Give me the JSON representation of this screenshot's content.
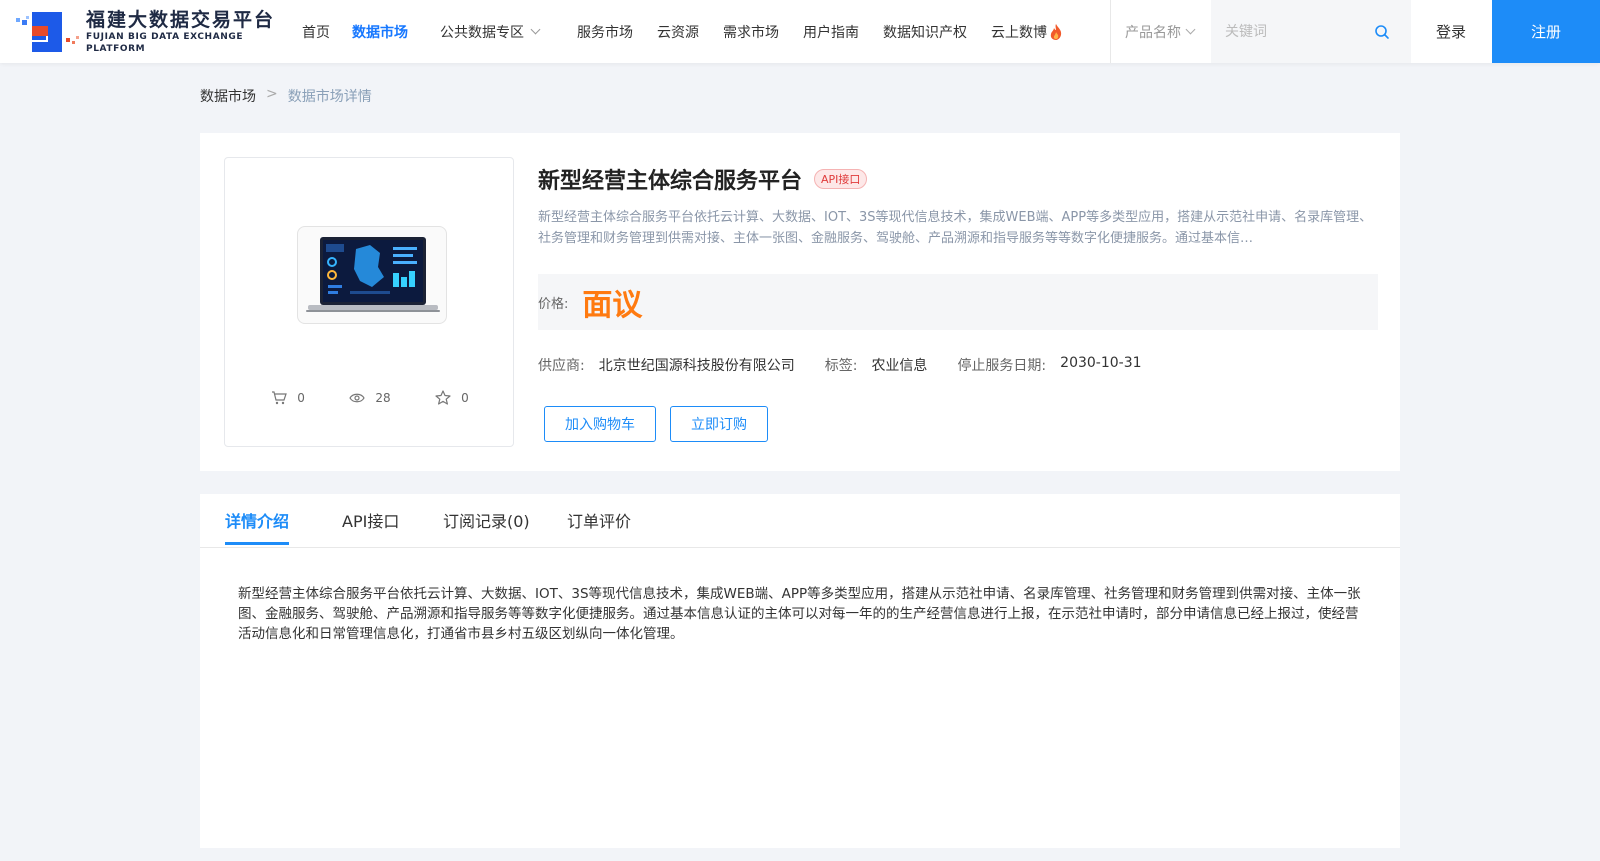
{
  "logo": {
    "cn": "福建大数据交易平台",
    "en": "FUJIAN BIG DATA EXCHANGE  PLATFORM"
  },
  "nav": [
    {
      "label": "首页"
    },
    {
      "label": "数据市场"
    },
    {
      "label": "公共数据专区"
    },
    {
      "label": "服务市场"
    },
    {
      "label": "云资源"
    },
    {
      "label": "需求市场"
    },
    {
      "label": "用户指南"
    },
    {
      "label": "数据知识产权"
    },
    {
      "label": "云上数博"
    }
  ],
  "search": {
    "category": "产品名称",
    "placeholder": "关键词"
  },
  "auth": {
    "login": "登录",
    "register": "注册"
  },
  "breadcrumb": {
    "root": "数据市场",
    "sep": ">",
    "current": "数据市场详情"
  },
  "product": {
    "title": "新型经营主体综合服务平台",
    "badge": "API接口",
    "desc": "新型经营主体综合服务平台依托云计算、大数据、IOT、3S等现代信息技术，集成WEB端、APP等多类型应用，搭建从示范社申请、名录库管理、社务管理和财务管理到供需对接、主体一张图、金融服务、驾驶舱、产品溯源和指导服务等等数字化便捷服务。通过基本信…",
    "price_label": "价格:",
    "price": "面议",
    "supplier_label": "供应商:",
    "supplier": "北京世纪国源科技股份有限公司",
    "tag_label": "标签:",
    "tag": "农业信息",
    "end_label": "停止服务日期:",
    "end_date": "2030-10-31",
    "cart_btn": "加入购物车",
    "buy_btn": "立即订购",
    "stats": {
      "cart": "0",
      "views": "28",
      "favorites": "0"
    }
  },
  "tabs": [
    {
      "label": "详情介绍"
    },
    {
      "label": "API接口"
    },
    {
      "label": "订阅记录(0)"
    },
    {
      "label": "订单评价"
    }
  ],
  "detail_text": "新型经营主体综合服务平台依托云计算、大数据、IOT、3S等现代信息技术，集成WEB端、APP等多类型应用，搭建从示范社申请、名录库管理、社务管理和财务管理到供需对接、主体一张图、金融服务、驾驶舱、产品溯源和指导服务等等数字化便捷服务。通过基本信息认证的主体可以对每一年的的生产经营信息进行上报，在示范社申请时，部分申请信息已经上报过，使经营活动信息化和日常管理信息化，打通省市县乡村五级区划纵向一体化管理。",
  "colors": {
    "accent": "#1d8cf8",
    "price": "#ff7a10",
    "badge": "#e03c3c"
  }
}
